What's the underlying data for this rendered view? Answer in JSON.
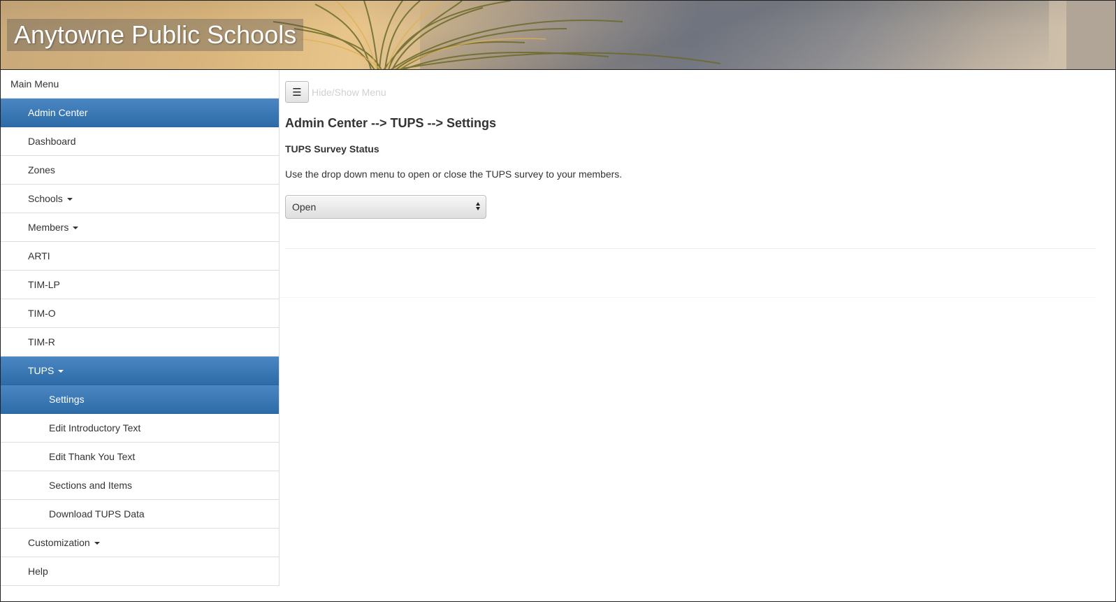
{
  "header": {
    "title": "Anytowne Public Schools"
  },
  "sidebar": {
    "heading": "Main Menu",
    "items": [
      {
        "label": "Admin Center"
      },
      {
        "label": "Dashboard"
      },
      {
        "label": "Zones"
      },
      {
        "label": "Schools"
      },
      {
        "label": "Members"
      },
      {
        "label": "ARTI"
      },
      {
        "label": "TIM-LP"
      },
      {
        "label": "TIM-O"
      },
      {
        "label": "TIM-R"
      },
      {
        "label": "TUPS"
      },
      {
        "label": "Settings"
      },
      {
        "label": "Edit Introductory Text"
      },
      {
        "label": "Edit Thank You Text"
      },
      {
        "label": "Sections and Items"
      },
      {
        "label": "Download TUPS Data"
      },
      {
        "label": "Customization"
      },
      {
        "label": "Help"
      }
    ]
  },
  "main": {
    "toggle_icon": "☰",
    "toggle_label": "Hide/Show Menu",
    "page_title": "Admin Center --> TUPS --> Settings",
    "section_title": "TUPS Survey Status",
    "instructions": "Use the drop down menu to open or close the TUPS survey to your members.",
    "status_select": {
      "selected": "Open"
    }
  },
  "colors": {
    "accent": "#337ab7",
    "text": "#333333",
    "border": "#dddddd"
  },
  "icons": {
    "menu_toggle": "hamburger-icon",
    "dropdown": "caret-down-icon",
    "select_arrows": "updown-arrows-icon"
  }
}
